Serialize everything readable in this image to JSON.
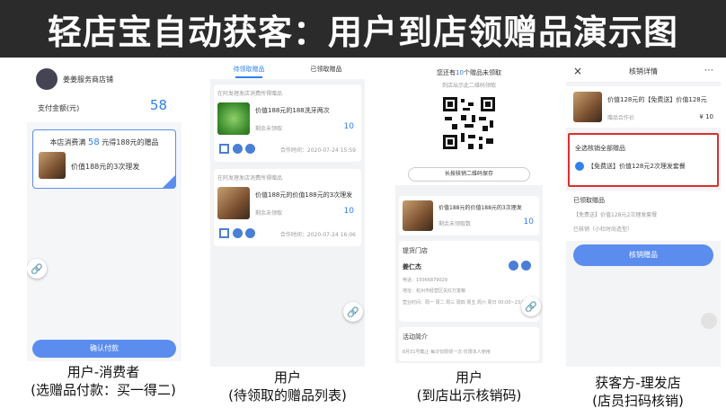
{
  "banner": {
    "title": "轻店宝自动获客：用户到店领赠品演示图"
  },
  "p1": {
    "store_name": "姜姜服务商店铺",
    "pay_label": "支付金额(元)",
    "pay_value": "58",
    "promo_pre": "本店消费满",
    "promo_num": "58",
    "promo_post": "元得188元的赠品",
    "gift_name": "价值188元的3次理发",
    "confirm": "确认付款",
    "caption1": "用户-消费者",
    "caption2": "(选赠品付款：买一得二)"
  },
  "p2": {
    "tab1": "待领取赠品",
    "tab2": "已领取赠品",
    "card1_head": "在阿发理发店消费所得赠品",
    "card1_title": "价值188元的188洗牙两次",
    "card1_remain": "剩余未领取",
    "card1_count": "10",
    "card1_time": "合作时间：2020-07-24 15:59",
    "card2_head": "在阿发理发店消费所得赠品",
    "card2_title": "价值188元的价值188元的3次理发",
    "card2_remain": "剩余未领取",
    "card2_count": "10",
    "card2_time": "合作时间：2020-07-24 16:06",
    "caption1": "用户",
    "caption2": "(待领取的赠品列表)"
  },
  "p3": {
    "top_pre": "您还有",
    "top_num": "10",
    "top_post": "个赠品未领取",
    "top_sub": "到店出示此二维码领取",
    "save_btn": "长按核销二维码保存",
    "gift_title": "价值188元的价值188元的3次理发",
    "gift_remain": "剩余未领取数",
    "gift_count": "10",
    "store_section": "提货门店",
    "person": "姜仁杰",
    "phone": "电话：15066879029",
    "address": "地址：杭州市经营区关红万富粮",
    "hours": "营业时间：周一 周二 周三 周四 周五 周六 周日 00:00~23:59",
    "activity": "活动简介",
    "activity_text": "8月31号截止 每次仅限领一次 仅限本人使用",
    "caption1": "用户",
    "caption2": "(到店出示核销码)"
  },
  "p4": {
    "title": "核销详情",
    "close": "×",
    "more": "⋯",
    "gift_title": "价值128元的【免费送】价值128元",
    "gift_label": "赠品合作价",
    "gift_price": "¥ 10",
    "select_all": "全选核销全部赠品",
    "item": "【免费送】价值128元2次理发套餐",
    "received_label": "已领取赠品",
    "received_item": "【免费送】价值128元2次理发套餐",
    "received_store": "已核销（小杜时尚造型）",
    "verify_btn": "核销赠品",
    "caption1": "获客方-理发店",
    "caption2": "(店员扫码核销)"
  }
}
